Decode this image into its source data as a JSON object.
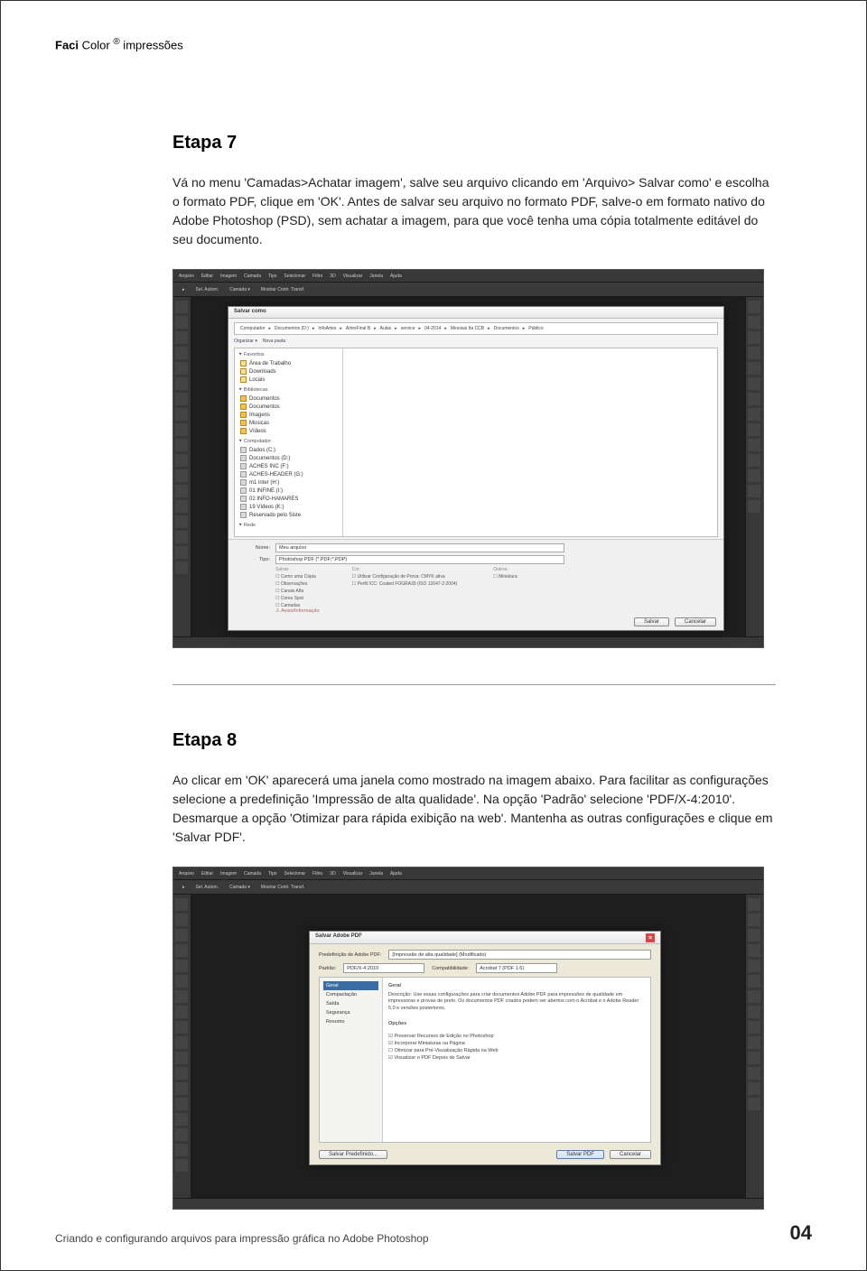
{
  "header": {
    "brand_bold": "Faci",
    "brand_rest": " Color ",
    "reg": "®",
    "brand_suffix": " impressões"
  },
  "step7": {
    "title": "Etapa 7",
    "body": "Vá no menu 'Camadas>Achatar imagem', salve seu arquivo clicando em 'Arquivo> Salvar como' e escolha o formato PDF, clique em 'OK'. Antes de salvar seu arquivo no formato PDF, salve-o em formato nativo do Adobe Photoshop (PSD), sem achatar a imagem, para que você tenha uma cópia totalmente editável do seu documento."
  },
  "step8": {
    "title": "Etapa 8",
    "body": "Ao clicar em 'OK' aparecerá uma janela como mostrado na imagem abaixo. Para facilitar as configurações selecione a predefinição 'Impressão de alta qualidade'. Na opção 'Padrão' selecione 'PDF/X-4:2010'. Desmarque a opção 'Otimizar para rápida exibição na web'. Mantenha as outras configurações e clique em 'Salvar PDF'."
  },
  "footer": {
    "text": "Criando e configurando arquivos para impressão gráfica no Adobe Photoshop",
    "page": "04"
  },
  "ps_menu": [
    "Arquivo",
    "Editar",
    "Imagem",
    "Camada",
    "Tipo",
    "Selecionar",
    "Filtro",
    "3D",
    "Visualizar",
    "Janela",
    "Ajuda"
  ],
  "save_dialog": {
    "title": "Salvar como",
    "path_segments": [
      "Computador",
      "Documentos (D:)",
      "InfoArtes",
      "ArtesFinal B",
      "Aulas",
      "service",
      "04-2014",
      "Messias Ita CCB",
      "Documentos",
      "Público"
    ],
    "organize": "Organizar ▾",
    "newfolder": "Nova pasta",
    "favorites_label": "Favoritos",
    "favorites": [
      "Área de Trabalho",
      "Downloads",
      "Locais"
    ],
    "libraries_label": "Bibliotecas",
    "libraries": [
      "Documentos",
      "Documentos",
      "Imagens",
      "Músicas",
      "Vídeos"
    ],
    "computer_label": "Computador",
    "computer": [
      "Dados (C:)",
      "Documentos (D:)",
      "ACHES INC (F:)",
      "ACHES-HEADER (G:)",
      "m1 inter (H:)",
      "01 INFINE (I:)",
      "02 INFO-HAMARES",
      "19 Vídeos (K:)",
      "Reservado pelo Siste"
    ],
    "network_label": "Rede",
    "filename_label": "Nome:",
    "filename_value": "Meu arquivo",
    "type_label": "Tipo:",
    "type_value": "Photoshop PDF (*.PDF;*.PDP)",
    "opts_save": {
      "header": "Salvar:",
      "items": [
        "Como uma Cópia",
        "Observações",
        "Canais Alfa",
        "Cores Spot",
        "Camadas"
      ]
    },
    "opts_color": {
      "header": "Cor:",
      "items": [
        "Utilizar Configuração de Prova: CMYK ativa",
        "Perfil ICC: Coated FOGRA39 (ISO 12647-2:2004)"
      ]
    },
    "opts_other": {
      "header": "Outros:",
      "items": [
        "Miniatura"
      ]
    },
    "warn": "⚠ Aviso/Informação",
    "btn_save": "Salvar",
    "btn_cancel": "Cancelar"
  },
  "pdf_dialog": {
    "title": "Salvar Adobe PDF",
    "preset_label": "Predefinição de Adobe PDF:",
    "preset_value": "[Impressão de alta qualidade] (Modificado)",
    "std_label": "Padrão:",
    "std_value": "PDF/X-4:2010",
    "compat_label": "Compatibilidade:",
    "compat_value": "Acrobat 7 (PDF 1.6)",
    "side": [
      "Geral",
      "Compactação",
      "Saída",
      "Segurança",
      "Resumo"
    ],
    "section_title": "Geral",
    "desc_label": "Descrição:",
    "desc_text": "Use essas configurações para criar documentos Adobe PDF para impressões de qualidade em impressoras e provas de prelo. Os documentos PDF criados podem ser abertos com o Acrobat e o Adobe Reader 5.0 e versões posteriores.",
    "options_title": "Opções",
    "checks": [
      "Preservar Recursos de Edição no Photoshop",
      "Incorporar Miniaturas na Página",
      "Otimizar para Pré-Visualização Rápida na Web",
      "Visualizar o PDF Depois de Salvar"
    ],
    "btn_savepreset": "Salvar Predefinido...",
    "btn_savepdf": "Salvar PDF",
    "btn_cancel": "Cancelar"
  }
}
